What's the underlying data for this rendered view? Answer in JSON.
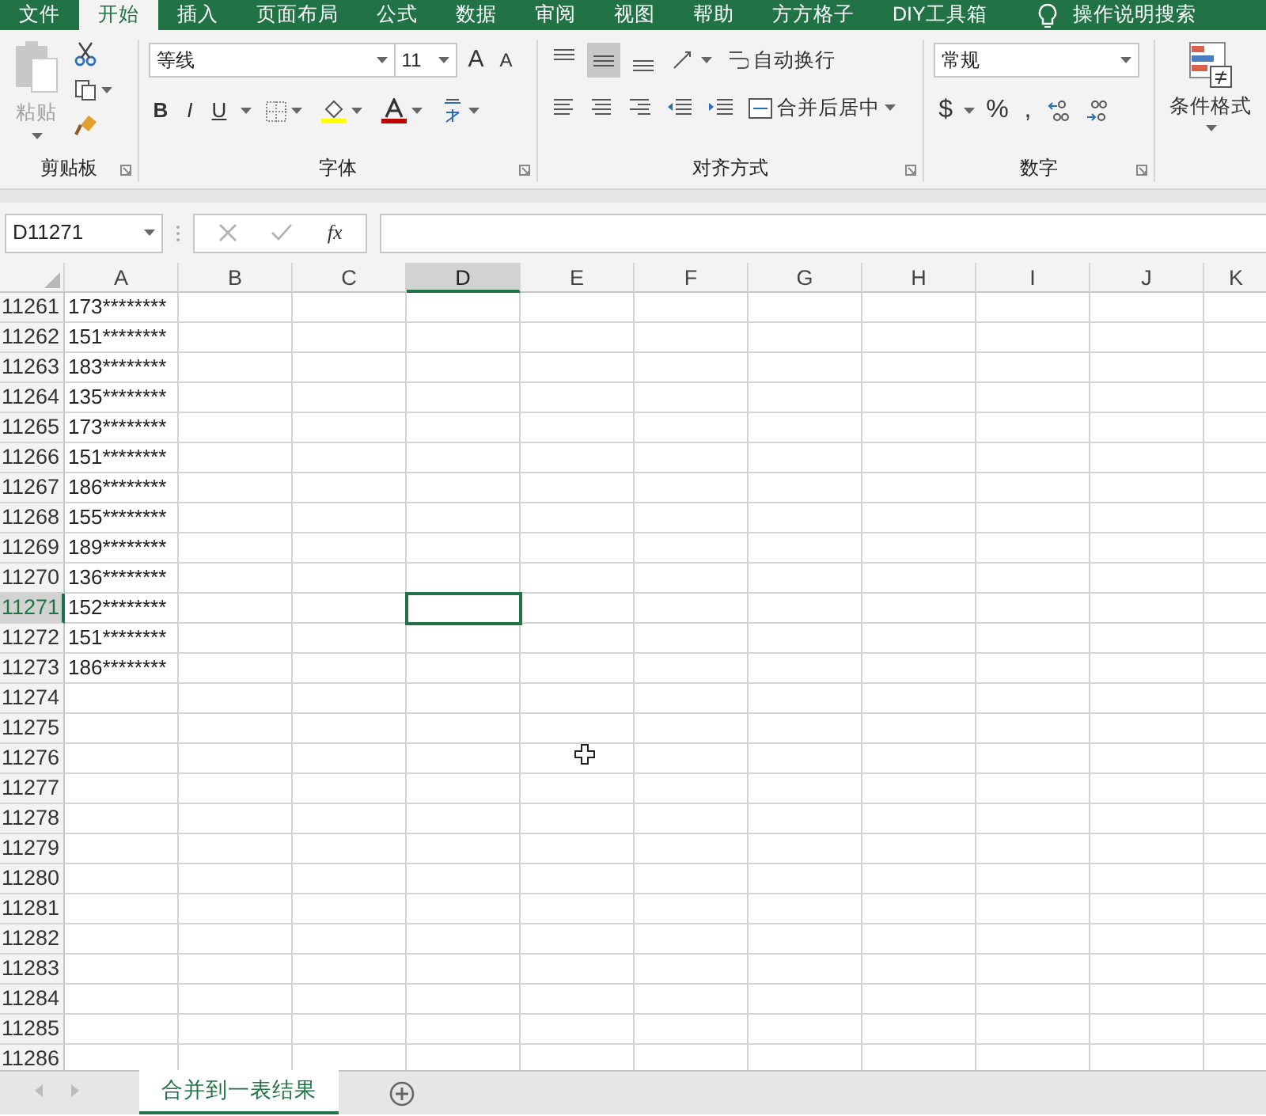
{
  "menu_tabs": [
    {
      "label": "文件",
      "selected": false
    },
    {
      "label": "开始",
      "selected": true
    },
    {
      "label": "插入",
      "selected": false
    },
    {
      "label": "页面布局",
      "selected": false
    },
    {
      "label": "公式",
      "selected": false
    },
    {
      "label": "数据",
      "selected": false
    },
    {
      "label": "审阅",
      "selected": false
    },
    {
      "label": "视图",
      "selected": false
    },
    {
      "label": "帮助",
      "selected": false
    },
    {
      "label": "方方格子",
      "selected": false
    },
    {
      "label": "DIY工具箱",
      "selected": false
    }
  ],
  "tell_me": "操作说明搜索",
  "clipboard": {
    "label": "剪贴板",
    "paste": "粘贴",
    "paste_disabled": true
  },
  "font": {
    "label": "字体",
    "font_name": "等线",
    "font_size": "11",
    "grow": "A",
    "shrink": "A",
    "styles": [
      "B",
      "I",
      "U"
    ]
  },
  "alignment": {
    "label": "对齐方式",
    "vertical": [
      {
        "selected": false
      },
      {
        "selected": true
      },
      {
        "selected": false
      }
    ],
    "wrap_text": "自动换行",
    "merge_center": "合并后居中"
  },
  "number": {
    "label": "数字",
    "format": "常规",
    "symbols": [
      "$",
      "%",
      ","
    ]
  },
  "styles": {
    "conditional_formatting": "条件格式"
  },
  "formula_bar": {
    "name_box": "D11271",
    "function_label": "fx"
  },
  "columns": [
    {
      "label": "A",
      "selected": false
    },
    {
      "label": "B",
      "selected": false
    },
    {
      "label": "C",
      "selected": false
    },
    {
      "label": "D",
      "selected": true
    },
    {
      "label": "E",
      "selected": false
    },
    {
      "label": "F",
      "selected": false
    },
    {
      "label": "G",
      "selected": false
    },
    {
      "label": "H",
      "selected": false
    },
    {
      "label": "I",
      "selected": false
    },
    {
      "label": "J",
      "selected": false
    },
    {
      "label": "K",
      "selected": false
    }
  ],
  "rows": [
    {
      "number": "11261",
      "a": "173********",
      "selected": false
    },
    {
      "number": "11262",
      "a": "151********",
      "selected": false
    },
    {
      "number": "11263",
      "a": "183********",
      "selected": false
    },
    {
      "number": "11264",
      "a": "135********",
      "selected": false
    },
    {
      "number": "11265",
      "a": "173********",
      "selected": false
    },
    {
      "number": "11266",
      "a": "151********",
      "selected": false
    },
    {
      "number": "11267",
      "a": "186********",
      "selected": false
    },
    {
      "number": "11268",
      "a": "155********",
      "selected": false
    },
    {
      "number": "11269",
      "a": "189********",
      "selected": false
    },
    {
      "number": "11270",
      "a": "136********",
      "selected": false
    },
    {
      "number": "11271",
      "a": "152********",
      "selected": true
    },
    {
      "number": "11272",
      "a": "151********",
      "selected": false
    },
    {
      "number": "11273",
      "a": "186********",
      "selected": false
    },
    {
      "number": "11274",
      "selected": false
    },
    {
      "number": "11275",
      "selected": false
    },
    {
      "number": "11276",
      "selected": false
    },
    {
      "number": "11277",
      "selected": false
    },
    {
      "number": "11278",
      "selected": false
    },
    {
      "number": "11279",
      "selected": false
    },
    {
      "number": "11280",
      "selected": false
    },
    {
      "number": "11281",
      "selected": false
    },
    {
      "number": "11282",
      "selected": false
    },
    {
      "number": "11283",
      "selected": false
    },
    {
      "number": "11284",
      "selected": false
    },
    {
      "number": "11285",
      "selected": false
    },
    {
      "number": "11286",
      "selected": false
    }
  ],
  "sheet_tabs": [
    {
      "label": "合并到一表结果",
      "selected": true
    }
  ]
}
